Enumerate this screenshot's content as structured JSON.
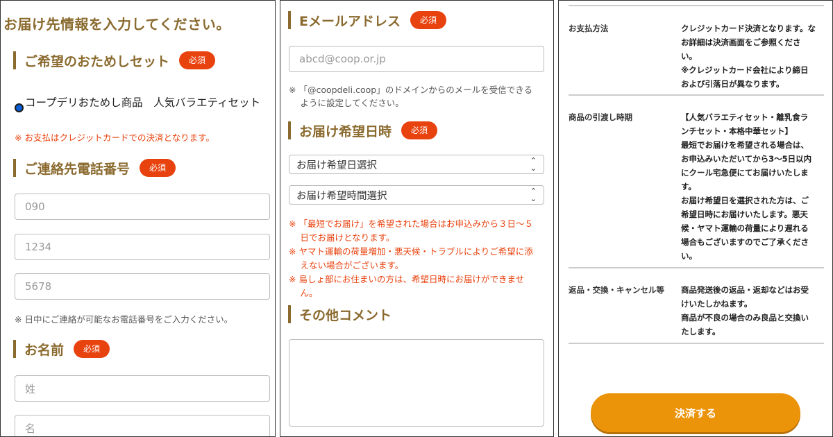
{
  "panel1": {
    "page_title": "お届け先情報を入力してください。",
    "set_section": {
      "title": "ご希望のおためしセット",
      "badge": "必須"
    },
    "set_option": "コープデリおためし商品　人気バラエティセット",
    "payment_note": "※ お支払はクレジットカードでの決済となります。",
    "phone_section": {
      "title": "ご連絡先電話番号",
      "badge": "必須"
    },
    "phone_placeholders": [
      "090",
      "1234",
      "5678"
    ],
    "phone_note": "※ 日中にご連絡が可能なお電話番号をご入力ください。",
    "name_section": {
      "title": "お名前",
      "badge": "必須"
    },
    "name_placeholders": [
      "姓",
      "名"
    ]
  },
  "panel2": {
    "email_section": {
      "title": "Eメールアドレス",
      "badge": "必須"
    },
    "email_placeholder": "abcd@coop.or.jp",
    "email_note_lines": [
      "※ 「@coopdeli.coop」のドメインからのメールを受信できる",
      "　 ように設定してください。"
    ],
    "delivery_section": {
      "title": "お届け希望日時",
      "badge": "必須"
    },
    "date_select": "お届け希望日選択",
    "time_select": "お届け希望時間選択",
    "delivery_notes": [
      "※ 「最短でお届け」を希望された場合はお申込みから３日〜５",
      "　 日でお届けとなります。",
      "※ ヤマト運輸の荷量増加・悪天候・トラブルによりご希望に添",
      "　 えない場合がございます。",
      "※ 島しょ部にお住まいの方は、希望日時にお届けができませ",
      "　 ん。"
    ],
    "comment_section": {
      "title": "その他コメント"
    }
  },
  "panel3": {
    "rows": [
      {
        "label": "お支払方法",
        "value": "クレジットカード決済となります。な\nお詳細は決済画面をご参照くださ\nい。\n※クレジットカード会社により締日\nおよび引落日が異なります。"
      },
      {
        "label": "商品の引渡し時期",
        "value": "【人気バラエティセット・離乳食ラ\nンチセット・本格中華セット】\n最短でお届けを希望される場合は、\nお申込みいただいてから3～5日以内\nにクール宅急便にてお届けいたしま\nす。\nお届け希望日を選択された方は、ご\n希望日時にお届けいたします。悪天\n候・ヤマト運輸の荷量により遅れる\n場合もございますのでご了承くださ\nい。"
      },
      {
        "label": "返品・交換・キャンセル等",
        "value": "商品発送後の返品・返却などはお受\nけいたしかねます。\n商品が不良の場合のみ良品と交換い\nたします。"
      }
    ],
    "pay_button": "決済する"
  },
  "colors": {
    "brand_brown": "#8a6a2e",
    "required_red": "#e8420e",
    "button_orange": "#ec9409"
  }
}
